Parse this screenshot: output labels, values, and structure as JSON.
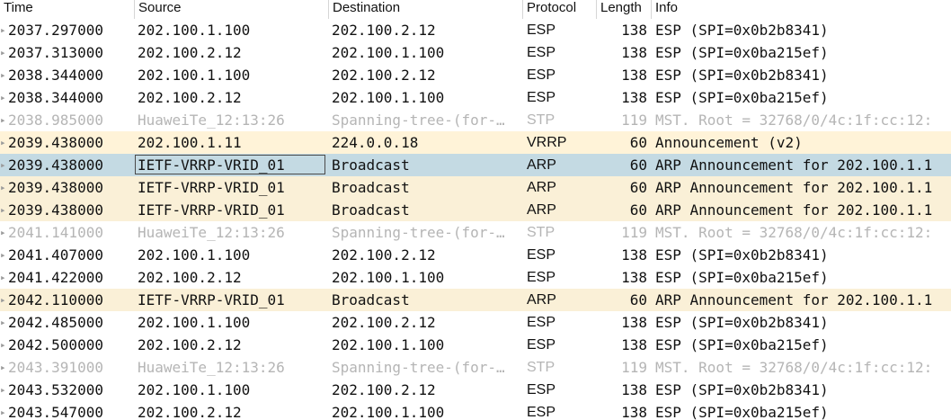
{
  "colors": {
    "normal_bg": "#ffffff",
    "normal_fg": "#111111",
    "vrrp_bg": "#fff3d8",
    "arp_bg": "#faf0d7",
    "selected_bg": "#c4dae3",
    "stp_fg": "#b5b5b5"
  },
  "columns": [
    "Time",
    "Source",
    "Destination",
    "Protocol",
    "Length",
    "Info"
  ],
  "packets": [
    {
      "time": "2037.297000",
      "source": "202.100.1.100",
      "destination": "202.100.2.12",
      "protocol": "ESP",
      "length": "138",
      "info": "ESP (SPI=0x0b2b8341)",
      "style": "normal"
    },
    {
      "time": "2037.313000",
      "source": "202.100.2.12",
      "destination": "202.100.1.100",
      "protocol": "ESP",
      "length": "138",
      "info": "ESP (SPI=0x0ba215ef)",
      "style": "normal"
    },
    {
      "time": "2038.344000",
      "source": "202.100.1.100",
      "destination": "202.100.2.12",
      "protocol": "ESP",
      "length": "138",
      "info": "ESP (SPI=0x0b2b8341)",
      "style": "normal"
    },
    {
      "time": "2038.344000",
      "source": "202.100.2.12",
      "destination": "202.100.1.100",
      "protocol": "ESP",
      "length": "138",
      "info": "ESP (SPI=0x0ba215ef)",
      "style": "normal"
    },
    {
      "time": "2038.985000",
      "source": "HuaweiTe_12:13:26",
      "destination": "Spanning-tree-(for-…",
      "protocol": "STP",
      "length": "119",
      "info": "MST. Root = 32768/0/4c:1f:cc:12:",
      "style": "stp"
    },
    {
      "time": "2039.438000",
      "source": "202.100.1.11",
      "destination": "224.0.0.18",
      "protocol": "VRRP",
      "length": "60",
      "info": "Announcement (v2)",
      "style": "vrrp"
    },
    {
      "time": "2039.438000",
      "source": "IETF-VRRP-VRID_01",
      "destination": "Broadcast",
      "protocol": "ARP",
      "length": "60",
      "info": "ARP Announcement for 202.100.1.1",
      "style": "selected"
    },
    {
      "time": "2039.438000",
      "source": "IETF-VRRP-VRID_01",
      "destination": "Broadcast",
      "protocol": "ARP",
      "length": "60",
      "info": "ARP Announcement for 202.100.1.1",
      "style": "arp"
    },
    {
      "time": "2039.438000",
      "source": "IETF-VRRP-VRID_01",
      "destination": "Broadcast",
      "protocol": "ARP",
      "length": "60",
      "info": "ARP Announcement for 202.100.1.1",
      "style": "arp"
    },
    {
      "time": "2041.141000",
      "source": "HuaweiTe_12:13:26",
      "destination": "Spanning-tree-(for-…",
      "protocol": "STP",
      "length": "119",
      "info": "MST. Root = 32768/0/4c:1f:cc:12:",
      "style": "stp"
    },
    {
      "time": "2041.407000",
      "source": "202.100.1.100",
      "destination": "202.100.2.12",
      "protocol": "ESP",
      "length": "138",
      "info": "ESP (SPI=0x0b2b8341)",
      "style": "normal"
    },
    {
      "time": "2041.422000",
      "source": "202.100.2.12",
      "destination": "202.100.1.100",
      "protocol": "ESP",
      "length": "138",
      "info": "ESP (SPI=0x0ba215ef)",
      "style": "normal"
    },
    {
      "time": "2042.110000",
      "source": "IETF-VRRP-VRID_01",
      "destination": "Broadcast",
      "protocol": "ARP",
      "length": "60",
      "info": "ARP Announcement for 202.100.1.1",
      "style": "arp"
    },
    {
      "time": "2042.485000",
      "source": "202.100.1.100",
      "destination": "202.100.2.12",
      "protocol": "ESP",
      "length": "138",
      "info": "ESP (SPI=0x0b2b8341)",
      "style": "normal"
    },
    {
      "time": "2042.500000",
      "source": "202.100.2.12",
      "destination": "202.100.1.100",
      "protocol": "ESP",
      "length": "138",
      "info": "ESP (SPI=0x0ba215ef)",
      "style": "normal"
    },
    {
      "time": "2043.391000",
      "source": "HuaweiTe_12:13:26",
      "destination": "Spanning-tree-(for-…",
      "protocol": "STP",
      "length": "119",
      "info": "MST. Root = 32768/0/4c:1f:cc:12:",
      "style": "stp"
    },
    {
      "time": "2043.532000",
      "source": "202.100.1.100",
      "destination": "202.100.2.12",
      "protocol": "ESP",
      "length": "138",
      "info": "ESP (SPI=0x0b2b8341)",
      "style": "normal"
    },
    {
      "time": "2043.547000",
      "source": "202.100.2.12",
      "destination": "202.100.1.100",
      "protocol": "ESP",
      "length": "138",
      "info": "ESP (SPI=0x0ba215ef)",
      "style": "normal"
    }
  ]
}
